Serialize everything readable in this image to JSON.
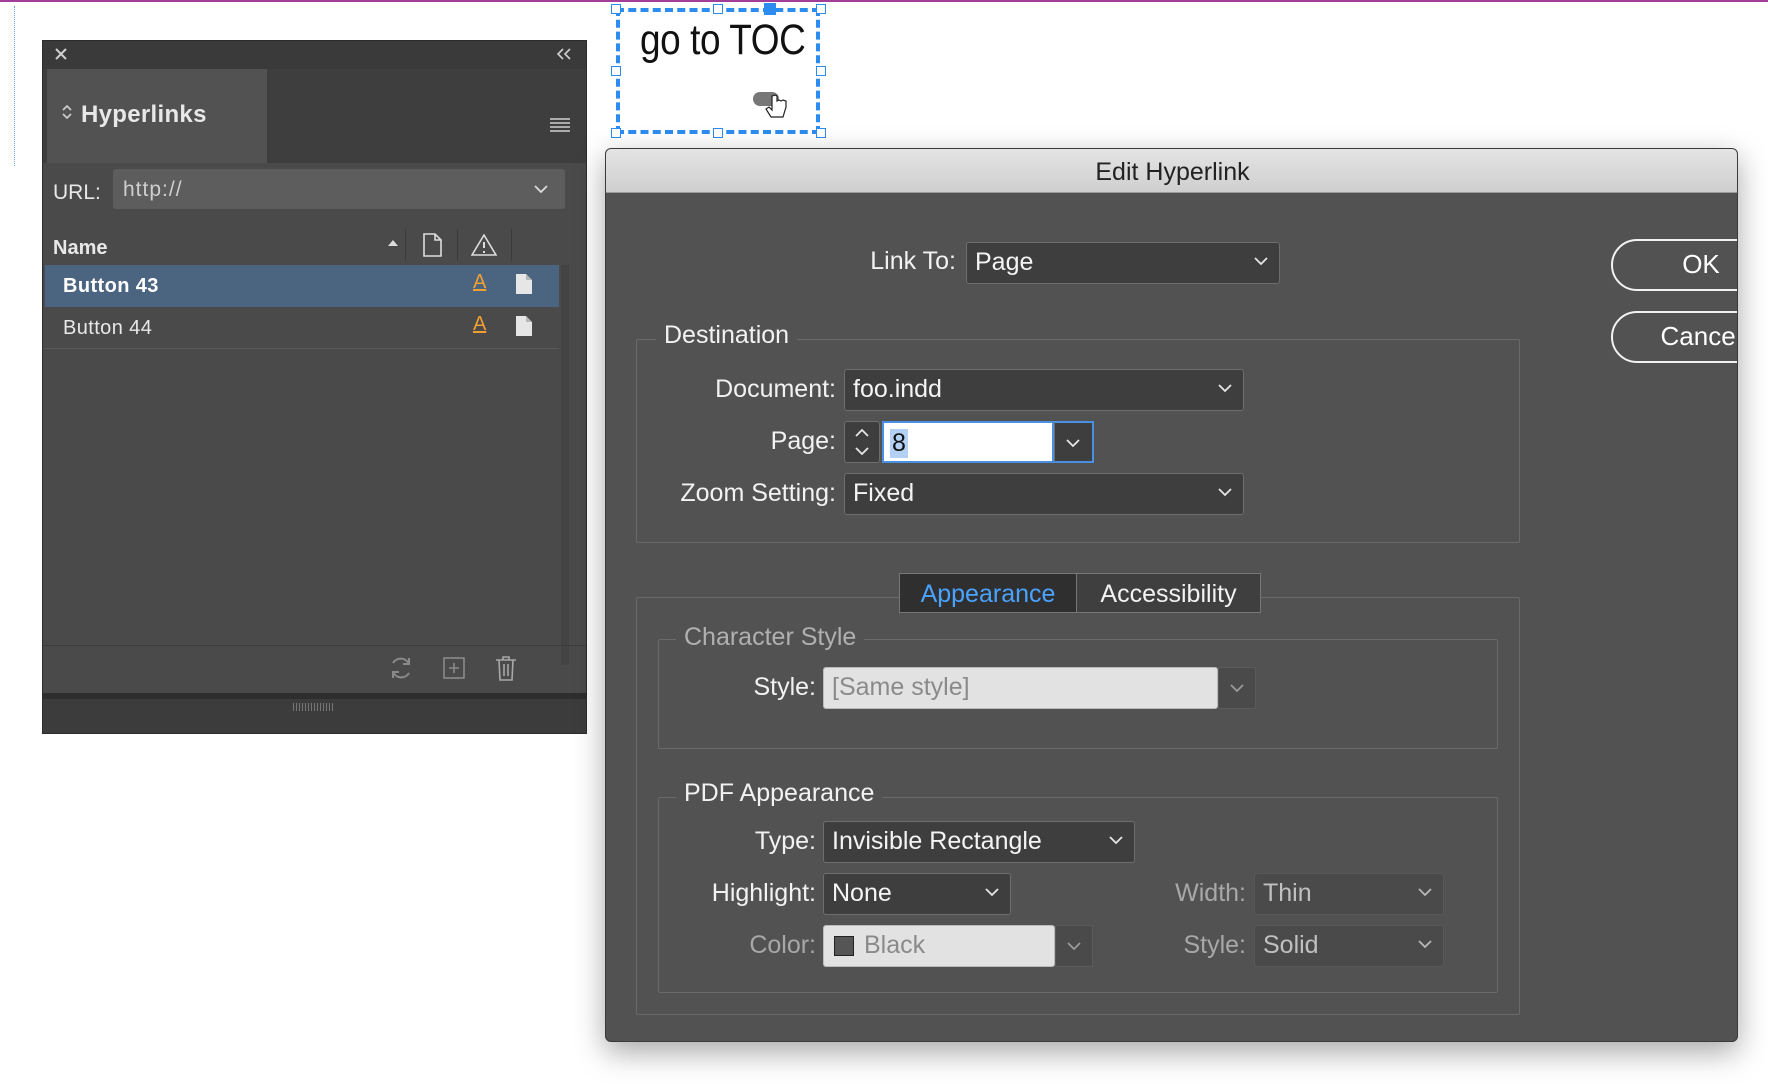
{
  "canvas": {
    "frame_text": "go to TOC"
  },
  "panel": {
    "title": "Hyperlinks",
    "url_label": "URL:",
    "url_value": "http://",
    "column_name": "Name",
    "rows": [
      {
        "name": "Button 43",
        "selected": true
      },
      {
        "name": "Button 44",
        "selected": false
      }
    ],
    "char_style_glyph": "A"
  },
  "dialog": {
    "title": "Edit Hyperlink",
    "link_to_label": "Link To:",
    "link_to_value": "Page",
    "destination_title": "Destination",
    "document_label": "Document:",
    "document_value": "foo.indd",
    "page_label": "Page:",
    "page_value": "8",
    "zoom_label": "Zoom Setting:",
    "zoom_value": "Fixed",
    "tab_appearance": "Appearance",
    "tab_accessibility": "Accessibility",
    "char_style_title": "Character Style",
    "style_label": "Style:",
    "style_value": "[Same style]",
    "pdf_title": "PDF Appearance",
    "type_label": "Type:",
    "type_value": "Invisible Rectangle",
    "highlight_label": "Highlight:",
    "highlight_value": "None",
    "width_label": "Width:",
    "width_value": "Thin",
    "color_label": "Color:",
    "color_value": "Black",
    "border_style_label": "Style:",
    "border_style_value": "Solid",
    "ok_label": "OK",
    "cancel_label": "Cancel"
  },
  "colors": {
    "accent": "#4aa3ff",
    "selection_row": "#4b6480",
    "frame_selection": "#2d8cf0",
    "char_style_icon": "#f0a030"
  }
}
